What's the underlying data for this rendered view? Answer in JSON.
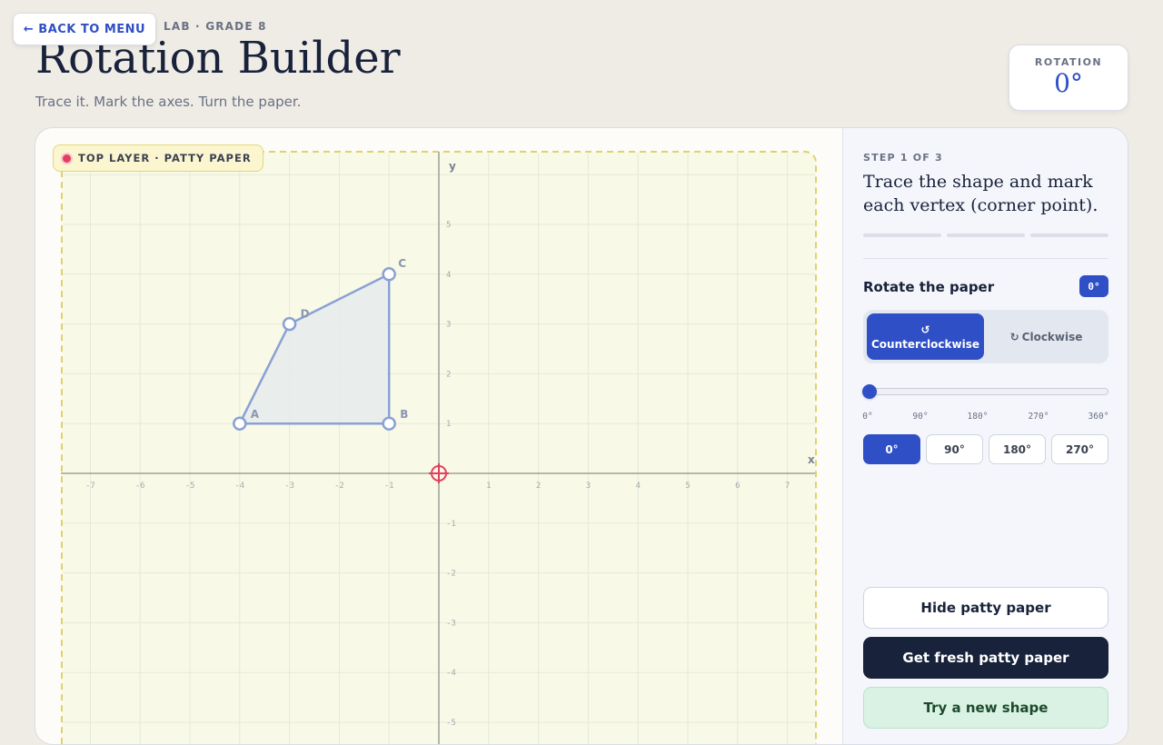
{
  "header": {
    "back_label": "← BACK TO MENU",
    "eyebrow": "LAB · GRADE 8",
    "title": "Rotation Builder",
    "subtitle": "Trace it. Mark the axes. Turn the paper."
  },
  "rotation_card": {
    "label": "ROTATION",
    "value": "0°"
  },
  "canvas": {
    "layer_tag": "TOP LAYER · PATTY PAPER",
    "axis_x_label": "x",
    "axis_y_label": "y",
    "x_ticks": [
      "-7",
      "-6",
      "-5",
      "-4",
      "-3",
      "-2",
      "-1",
      "1",
      "2",
      "3",
      "4",
      "5",
      "6",
      "7"
    ],
    "y_ticks": [
      "5",
      "4",
      "3",
      "2",
      "1",
      "-1",
      "-2",
      "-3",
      "-4",
      "-5"
    ],
    "shape": {
      "vertices": [
        {
          "label": "A",
          "x": -4,
          "y": 1
        },
        {
          "label": "B",
          "x": -1,
          "y": 1
        },
        {
          "label": "C",
          "x": -1,
          "y": 4
        },
        {
          "label": "D",
          "x": -3,
          "y": 3
        }
      ]
    },
    "center_of_rotation": {
      "x": 0,
      "y": 0
    },
    "colors": {
      "paper": "#f9f9e7",
      "paper_border": "#e0d16f",
      "grid": "#e4ead6",
      "axis": "#9aa39a",
      "shape_stroke": "#8aa1d3",
      "shape_fill": "#e6ecec",
      "center": "#e23f5f"
    }
  },
  "panel": {
    "step_label": "STEP 1 OF 3",
    "step_text": "Trace the shape and mark each vertex (corner point).",
    "progress_done": 0,
    "progress_total": 3,
    "section_title": "Rotate the paper",
    "degree_badge": "0°",
    "direction": {
      "ccw_icon": "↺",
      "ccw_label": "Counterclockwise",
      "cw_icon": "↻",
      "cw_label": "Clockwise",
      "selected": "ccw"
    },
    "slider": {
      "value": 0,
      "min": 0,
      "max": 360
    },
    "slider_ticks": [
      "0°",
      "90°",
      "180°",
      "270°",
      "360°"
    ],
    "presets": [
      "0°",
      "90°",
      "180°",
      "270°"
    ],
    "preset_selected": 0,
    "buttons": {
      "hide": "Hide patty paper",
      "fresh": "Get fresh patty paper",
      "new_shape": "Try a new shape"
    }
  },
  "accent": "#2f4fc6"
}
